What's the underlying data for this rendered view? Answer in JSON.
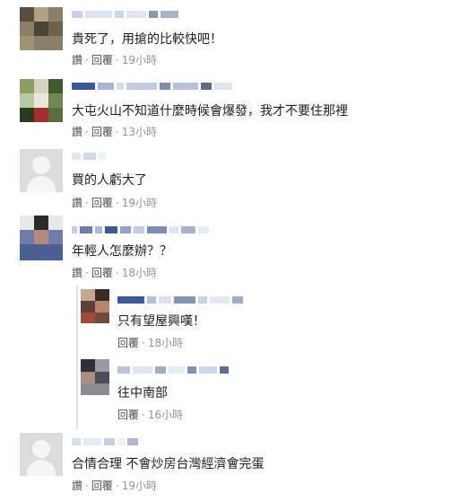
{
  "actions": {
    "like": "讚",
    "reply": "回覆",
    "sep": "·"
  },
  "comments": [
    {
      "text": "貴死了，用搶的比較快吧！",
      "time": "19小時"
    },
    {
      "text": "大屯火山不知道什麼時候會爆發，我才不要住那裡",
      "time": "13小時"
    },
    {
      "text": "買的人虧大了",
      "time": "19小時"
    },
    {
      "text": "年輕人怎麼辦？？",
      "time": "18小時"
    },
    {
      "text": "只有望屋興嘆！",
      "time": "18小時"
    },
    {
      "text": "往中南部",
      "time": "16小時"
    },
    {
      "text": "合情合理 不會炒房台灣經濟會完蛋",
      "time": "19小時"
    }
  ]
}
